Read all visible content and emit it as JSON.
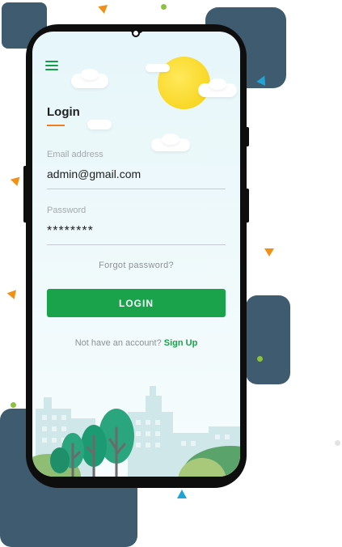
{
  "login": {
    "title": "Login",
    "email_label": "Email address",
    "email_value": "admin@gmail.com",
    "password_label": "Password",
    "password_value": "********",
    "forgot_label": "Forgot  password?",
    "login_button": "LOGIN",
    "no_account_text": "Not have an account?",
    "signup_link": "Sign Up"
  },
  "colors": {
    "accent_green": "#1aa34a",
    "accent_orange": "#f07d22",
    "bg_block": "#3f5b70",
    "sun": "#f5cf10"
  },
  "icons": [
    "menu-icon",
    "sun-icon",
    "cloud-icon",
    "city-skyline-illustration",
    "tree-illustration"
  ]
}
